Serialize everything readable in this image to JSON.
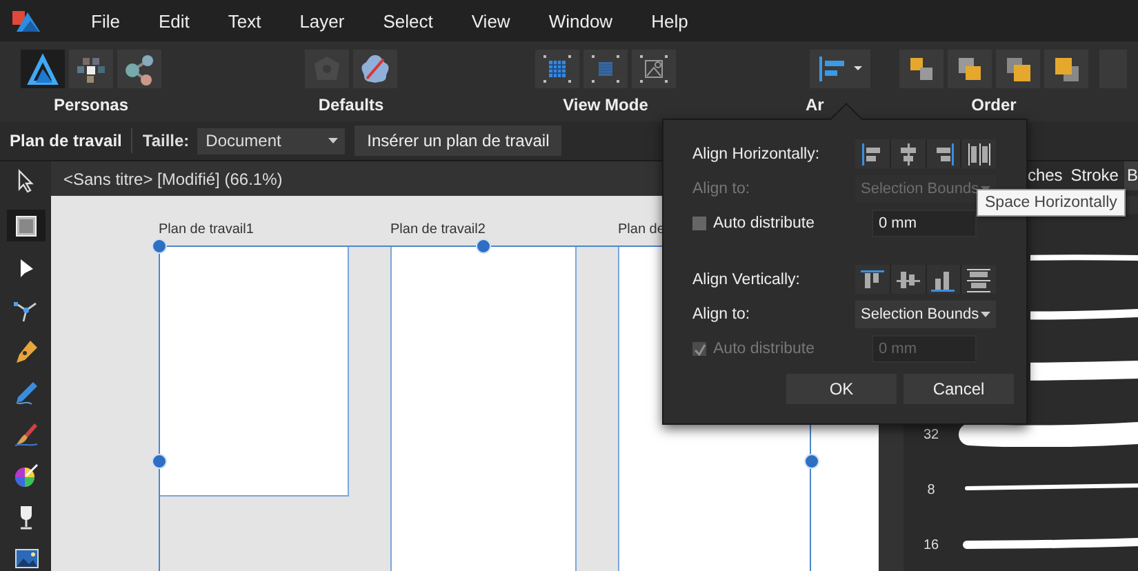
{
  "menu": [
    "File",
    "Edit",
    "Text",
    "Layer",
    "Select",
    "View",
    "Window",
    "Help"
  ],
  "toolbar": [
    {
      "label": "Personas",
      "buttons": [
        {
          "selected": true
        },
        {
          "selected": false
        },
        {
          "selected": false
        }
      ]
    },
    {
      "label": "Defaults",
      "buttons": [
        {
          "selected": false
        },
        {
          "selected": false
        }
      ]
    },
    {
      "label": "View Mode",
      "buttons": [
        {
          "selected": false
        },
        {
          "selected": false
        },
        {
          "selected": false
        }
      ]
    },
    {
      "label": "Ar",
      "buttons": [
        {
          "selected": false
        }
      ]
    },
    {
      "label": "Order",
      "buttons": [
        {
          "selected": false
        },
        {
          "selected": false
        },
        {
          "selected": false
        },
        {
          "selected": false
        }
      ]
    }
  ],
  "context_bar": {
    "title": "Plan de travail",
    "size_label": "Taille:",
    "size_value": "Document",
    "insert_button": "Insérer un plan de travail"
  },
  "tools": [
    {
      "selected": false
    },
    {
      "selected": true
    },
    {
      "selected": false
    },
    {
      "selected": false
    },
    {
      "selected": false
    },
    {
      "selected": false
    },
    {
      "selected": false
    },
    {
      "selected": false
    },
    {
      "selected": false
    },
    {
      "selected": false
    }
  ],
  "document": {
    "title": "<Sans titre> [Modifié] (66.1%)",
    "artboards": [
      {
        "label": "Plan de travail1"
      },
      {
        "label": "Plan de travail2"
      },
      {
        "label": "Plan de"
      }
    ]
  },
  "right_panel": {
    "tabs": [
      {
        "label": "ches",
        "selected": false
      },
      {
        "label": "Stroke",
        "selected": false
      },
      {
        "label": "B",
        "selected": true
      }
    ],
    "brush_sizes": [
      "32",
      "8",
      "16"
    ]
  },
  "align_popover": {
    "horizontal": {
      "label": "Align Horizontally:",
      "align_to_label": "Align to:",
      "align_to_value": "Selection Bounds",
      "align_to_disabled": true,
      "auto_distribute": {
        "label": "Auto distribute",
        "checked": false,
        "disabled": false
      },
      "spacing": "0 mm",
      "spacing_disabled": false
    },
    "vertical": {
      "label": "Align Vertically:",
      "align_to_label": "Align to:",
      "align_to_value": "Selection Bounds",
      "align_to_disabled": false,
      "auto_distribute": {
        "label": "Auto distribute",
        "checked": true,
        "disabled": true
      },
      "spacing": "0 mm",
      "spacing_disabled": true
    },
    "buttons": [
      "OK",
      "Cancel"
    ]
  },
  "tooltip": "Space Horizontally"
}
